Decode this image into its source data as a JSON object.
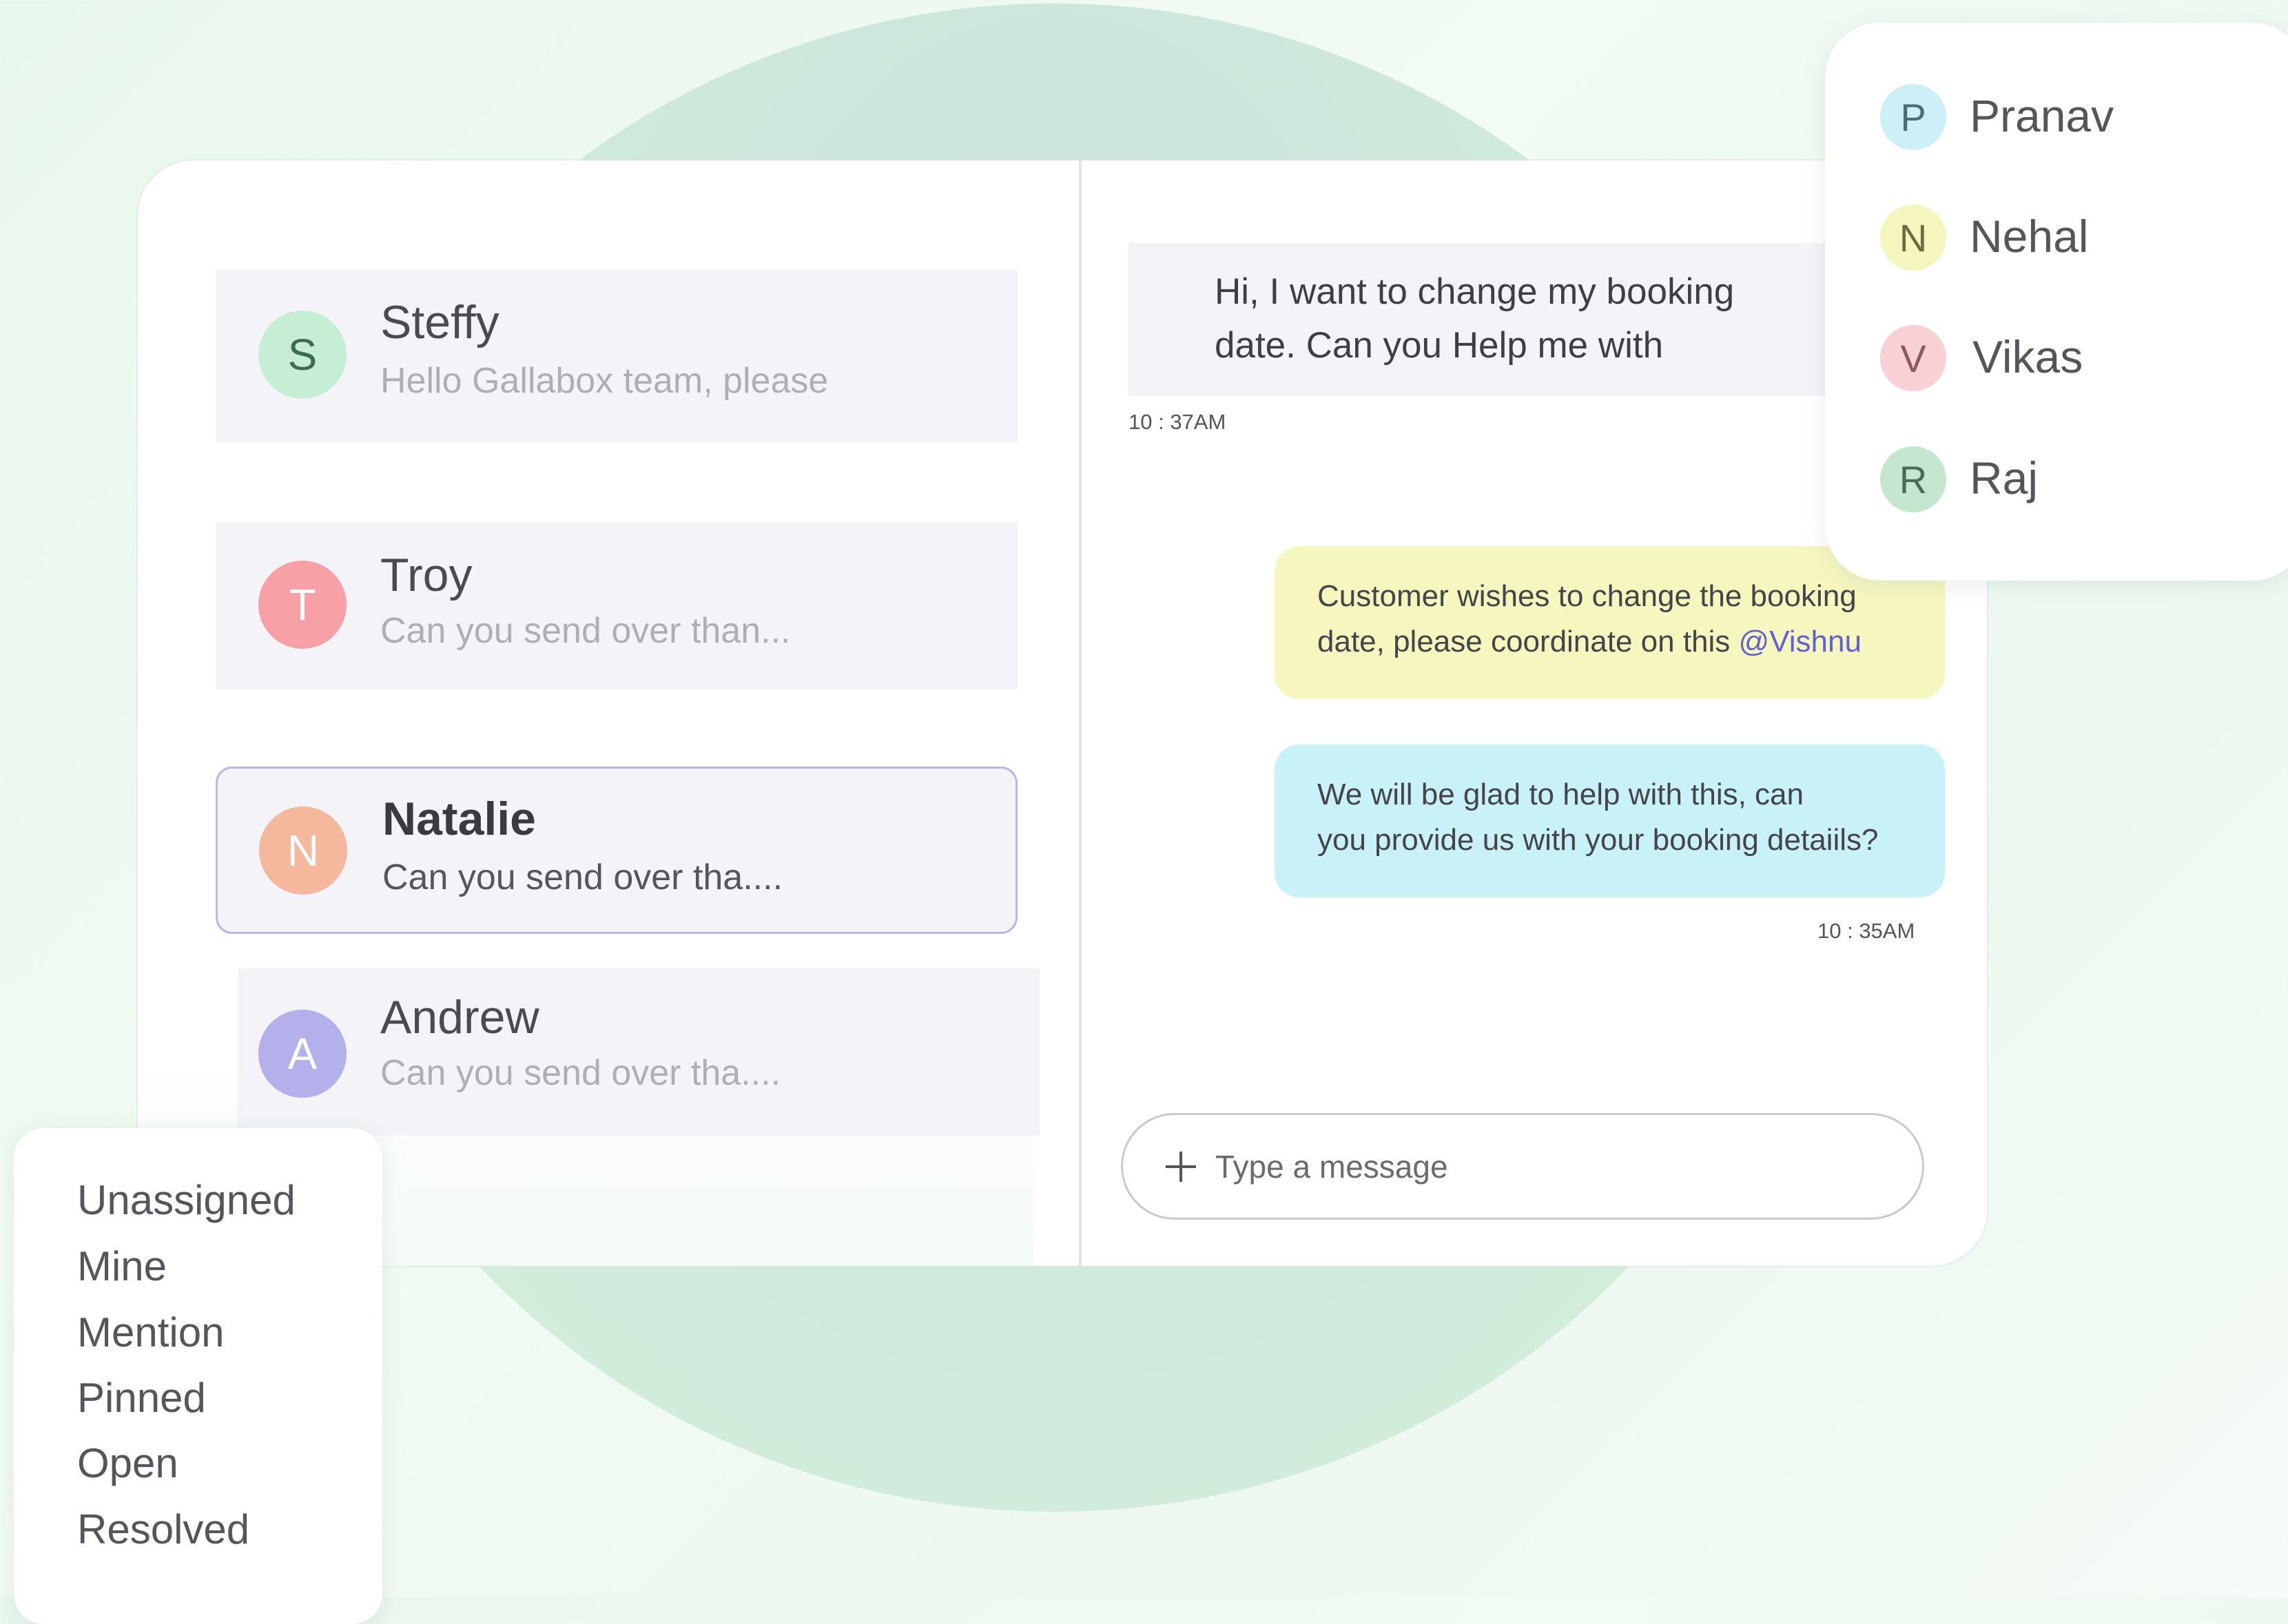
{
  "conversations": [
    {
      "initial": "S",
      "name": "Steffy",
      "preview": "Hello Gallabox team, please",
      "avatar_color": "#c5eed5",
      "avatar_text_color": "#3d6a50"
    },
    {
      "initial": "T",
      "name": "Troy",
      "preview": "Can you send over than...",
      "avatar_color": "#f7a0a6",
      "avatar_text_color": "#ffffff"
    },
    {
      "initial": "N",
      "name": "Natalie",
      "preview": "Can you send over tha....",
      "avatar_color": "#f5b89c",
      "avatar_text_color": "#ffffff",
      "active": true
    },
    {
      "initial": "A",
      "name": "Andrew",
      "preview": "Can you send over tha....",
      "avatar_color": "#b3b0eb",
      "avatar_text_color": "#ffffff"
    }
  ],
  "chat": {
    "incoming": {
      "line1": "Hi, I want to change my booking",
      "line2": "date. Can you Help me with",
      "time": "10 : 37AM"
    },
    "note": {
      "line1": "Customer wishes to change the  booking",
      "line2": "date, please coordinate on this ",
      "mention": "@Vishnu"
    },
    "outgoing": {
      "line1": "We will be glad to help with this, can",
      "line2": "you provide us with your booking detaiils?",
      "time": "10 : 35AM"
    },
    "composer": {
      "placeholder": "Type a message",
      "plus_icon": "plus-icon"
    }
  },
  "agents": [
    {
      "initial": "P",
      "name": "Pranav",
      "avatar_color": "#cdeff7",
      "avatar_text_color": "#4a6d78"
    },
    {
      "initial": "N",
      "name": "Nehal",
      "avatar_color": "#f5f6be",
      "avatar_text_color": "#6b6b40"
    },
    {
      "initial": "V",
      "name": "Vikas",
      "avatar_color": "#f9d1d4",
      "avatar_text_color": "#8a5a5e"
    },
    {
      "initial": "R",
      "name": "Raj",
      "avatar_color": "#c5e6cf",
      "avatar_text_color": "#4b6b55"
    }
  ],
  "filters": [
    "Unassigned",
    "Mine",
    "Mention",
    "Pinned",
    "Open",
    "Resolved"
  ]
}
